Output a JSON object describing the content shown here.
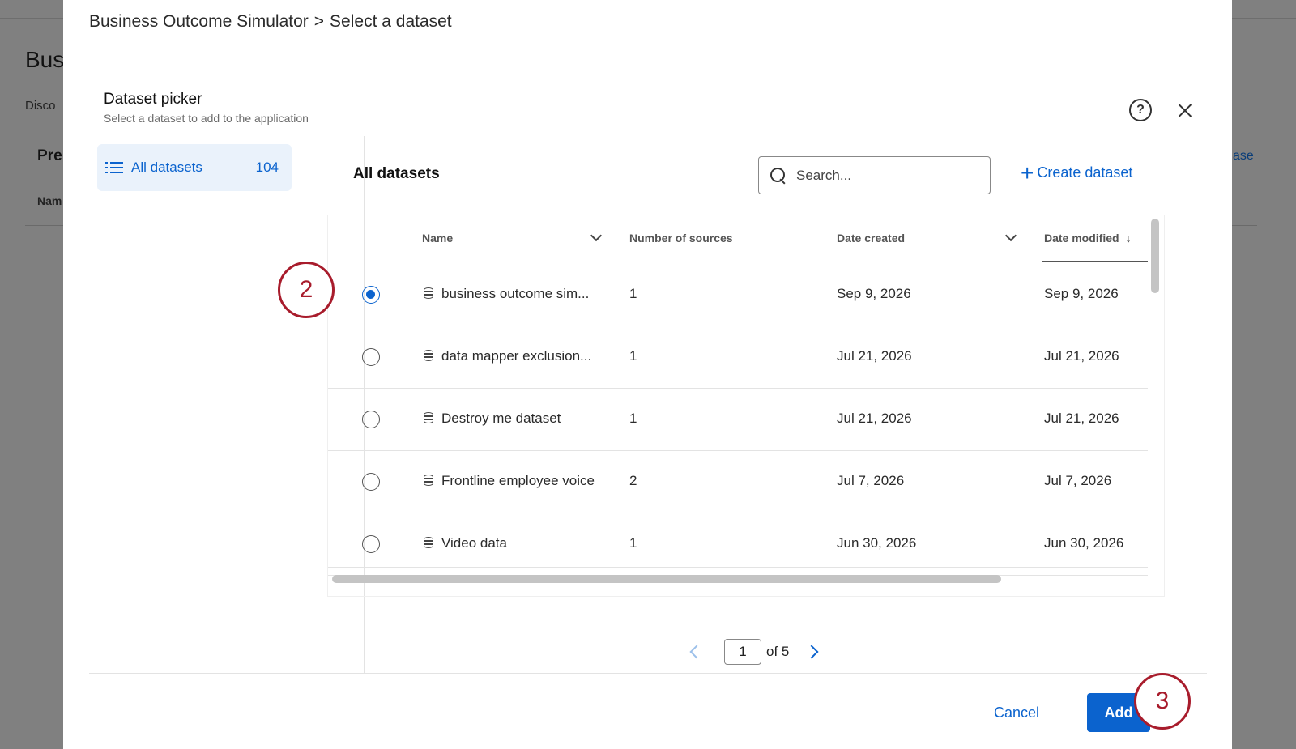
{
  "background": {
    "title": "Bus",
    "subtitle": "Disco",
    "section": "Pre",
    "column": "Nam",
    "link": "ase"
  },
  "modal": {
    "breadcrumb": [
      "Business Outcome Simulator",
      ">",
      "Select a dataset"
    ],
    "picker_title": "Dataset picker",
    "picker_subtitle": "Select a dataset to add to the application",
    "help_icon": "?",
    "sidebar": {
      "items": [
        {
          "label": "All datasets",
          "count": "104",
          "icon": "list-icon"
        }
      ]
    },
    "content_title": "All datasets",
    "search": {
      "placeholder": "Search...",
      "value": ""
    },
    "create_label": "Create dataset",
    "table": {
      "columns": [
        "Name",
        "Number of sources",
        "Date created",
        "Date modified"
      ],
      "sorted_by": "Date modified",
      "rows": [
        {
          "selected": true,
          "name": "business outcome sim...",
          "sources": "1",
          "created": "Sep 9, 2026",
          "modified": "Sep 9, 2026"
        },
        {
          "selected": false,
          "name": "data mapper exclusion...",
          "sources": "1",
          "created": "Jul 21, 2026",
          "modified": "Jul 21, 2026"
        },
        {
          "selected": false,
          "name": "Destroy me dataset",
          "sources": "1",
          "created": "Jul 21, 2026",
          "modified": "Jul 21, 2026"
        },
        {
          "selected": false,
          "name": "Frontline employee voice",
          "sources": "2",
          "created": "Jul 7, 2026",
          "modified": "Jul 7, 2026"
        },
        {
          "selected": false,
          "name": "Video data",
          "sources": "1",
          "created": "Jun 30, 2026",
          "modified": "Jun 30, 2026"
        }
      ]
    },
    "pagination": {
      "page": "1",
      "of_label": "of 5"
    },
    "footer": {
      "cancel_label": "Cancel",
      "add_label": "Add"
    }
  },
  "annotations": {
    "step_2": "2",
    "step_3": "3",
    "color": "#a81c2c"
  },
  "colors": {
    "accent": "#0b63ce",
    "selected_bg": "#eaf2fb"
  }
}
